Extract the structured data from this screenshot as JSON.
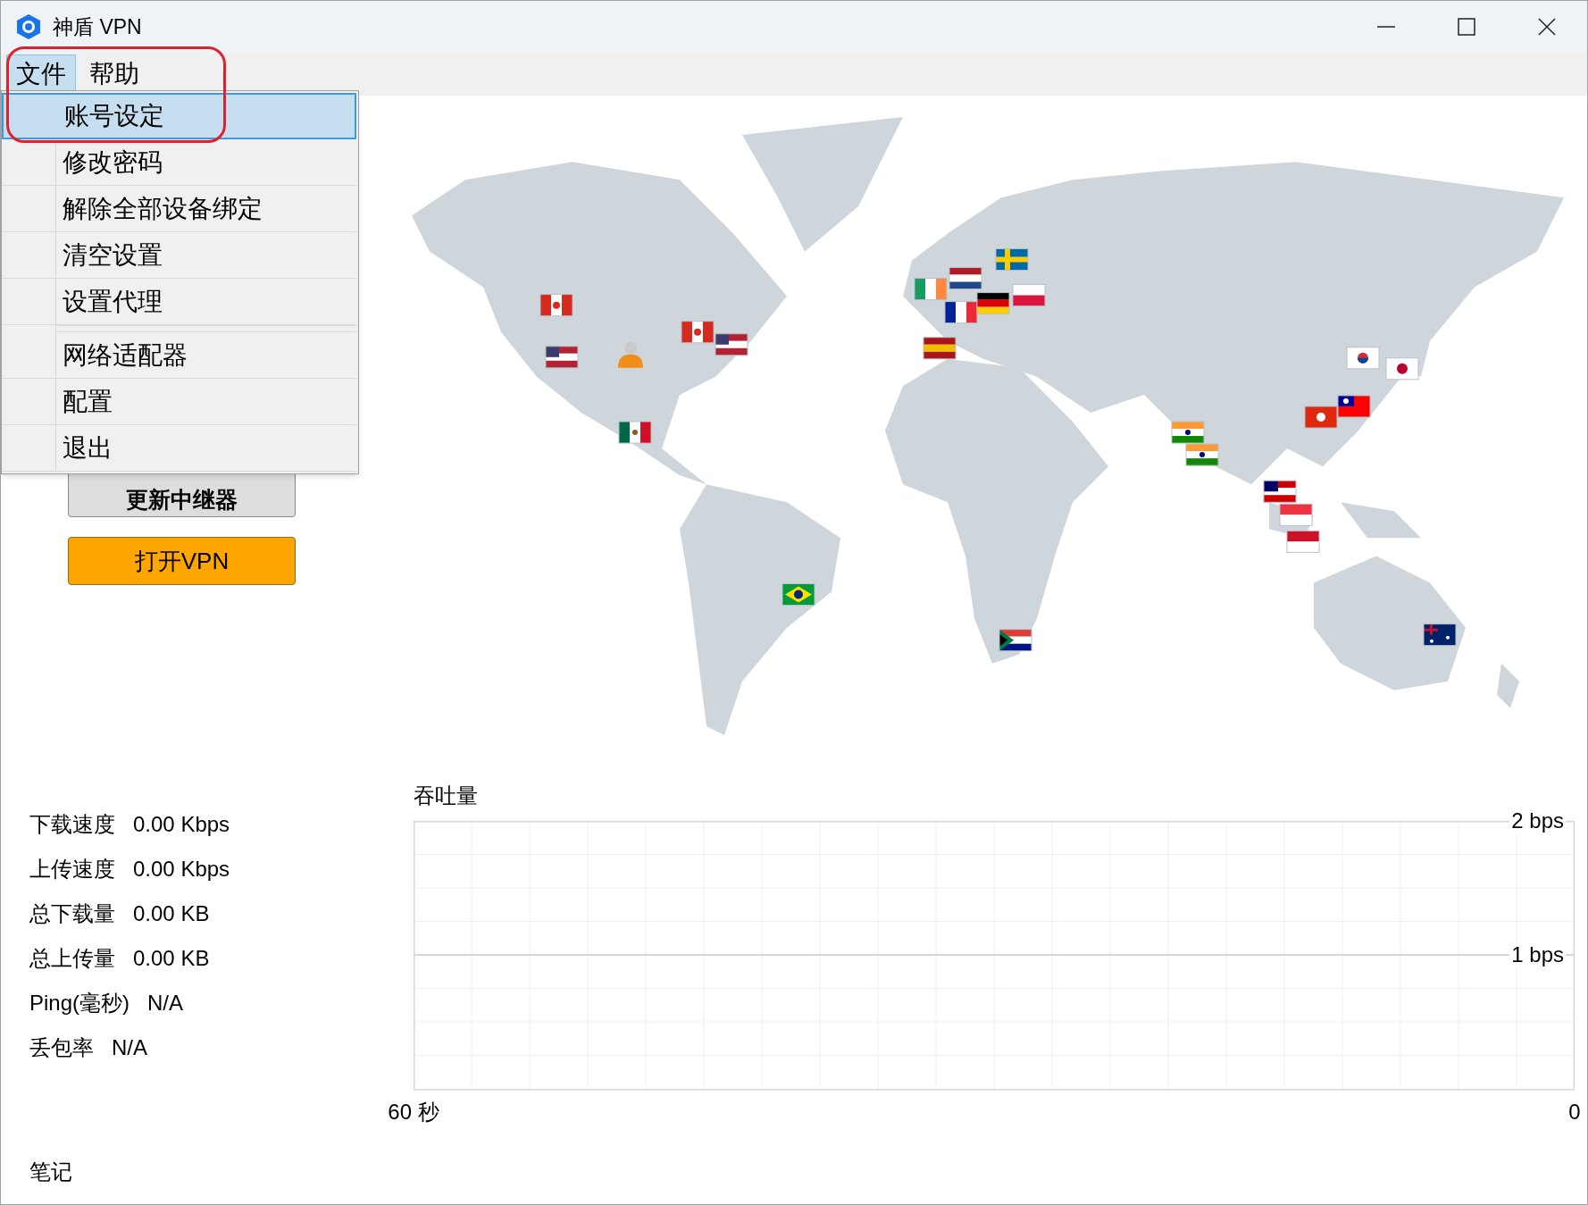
{
  "window": {
    "title": "神盾 VPN"
  },
  "menu_bar": [
    {
      "label": "文件",
      "selected": true
    },
    {
      "label": "帮助",
      "selected": false
    }
  ],
  "file_menu": [
    {
      "kind": "item",
      "label": "账号设定",
      "selected": true
    },
    {
      "kind": "item",
      "label": "修改密码",
      "selected": false
    },
    {
      "kind": "item",
      "label": "解除全部设备绑定",
      "selected": false
    },
    {
      "kind": "item",
      "label": "清空设置",
      "selected": false
    },
    {
      "kind": "item",
      "label": "设置代理",
      "selected": false
    },
    {
      "kind": "separator"
    },
    {
      "kind": "item",
      "label": "网络适配器",
      "selected": false
    },
    {
      "kind": "item",
      "label": "配置",
      "selected": false
    },
    {
      "kind": "item",
      "label": "退出",
      "selected": false
    }
  ],
  "buttons": [
    {
      "label": "更新中继器",
      "kind": "secondary"
    },
    {
      "label": "打开VPN",
      "kind": "primary"
    }
  ],
  "stats": [
    {
      "label": "下载速度",
      "value": "0.00 Kbps"
    },
    {
      "label": "上传速度",
      "value": "0.00 Kbps"
    },
    {
      "label": "总下载量",
      "value": "0.00 KB"
    },
    {
      "label": "总上传量",
      "value": "0.00 KB"
    },
    {
      "label": "Ping(毫秒)",
      "value": "N/A"
    },
    {
      "label": "丢包率",
      "value": "N/A"
    }
  ],
  "notes_label": "笔记",
  "throughput": {
    "chart_data": {
      "type": "line",
      "title": "吞吐量",
      "xlim": [
        60,
        0
      ],
      "ylim": [
        0,
        2
      ],
      "xticks": [
        {
          "value": 60,
          "label": "60 秒"
        },
        {
          "value": 0,
          "label": "0"
        }
      ],
      "yticks": [
        {
          "value": 2,
          "label": "2 bps"
        },
        {
          "value": 1,
          "label": "1 bps"
        }
      ]
    }
  }
}
